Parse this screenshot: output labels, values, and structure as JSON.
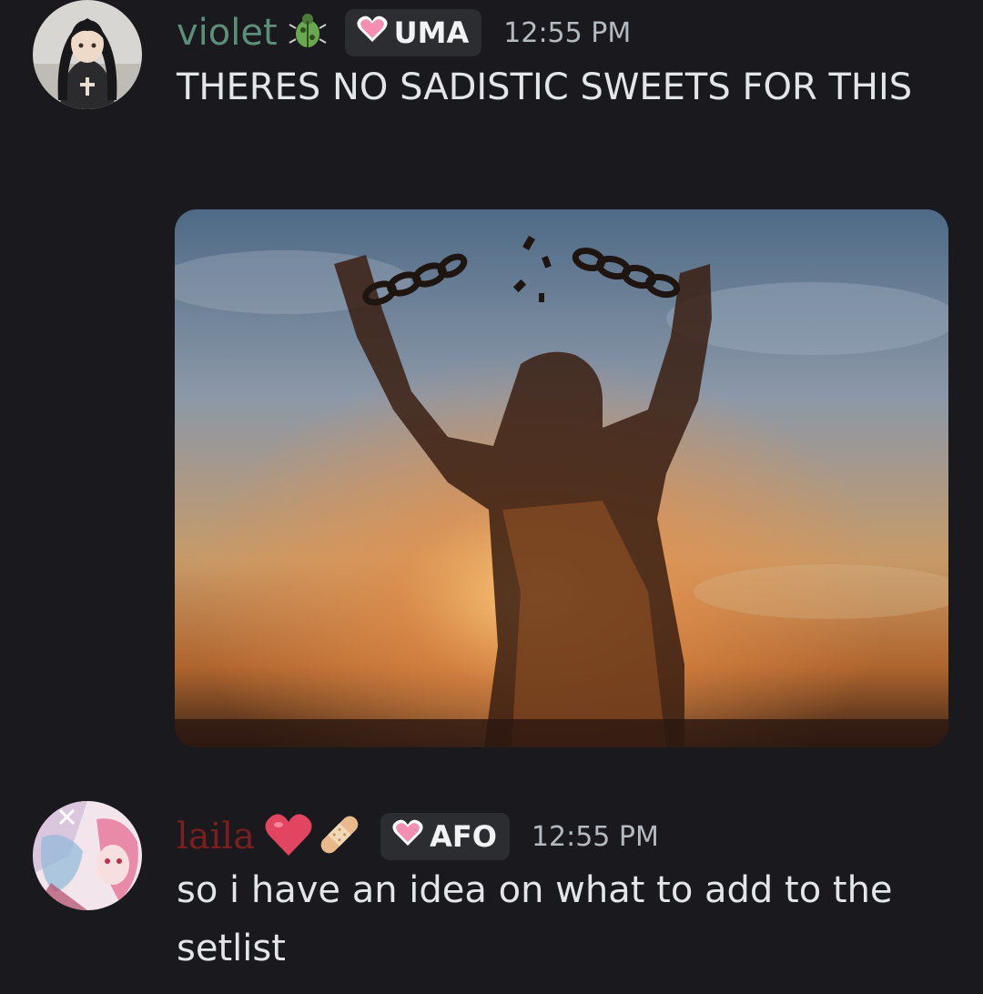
{
  "messages": [
    {
      "username": "violet",
      "username_color": "#5b8f79",
      "username_emoji": "beetle-icon",
      "tag": {
        "icon": "pink-heart-icon",
        "label": "UMA"
      },
      "timestamp": "12:55 PM",
      "text": "THERES NO SADISTIC SWEETS FOR THIS",
      "attachment": {
        "type": "image",
        "subject": "silhouette-breaking-chains-at-sunset"
      }
    },
    {
      "username": "laila",
      "username_color": "#7a1e1e",
      "username_emoji": [
        "red-heart-icon",
        "bandage-icon"
      ],
      "tag": {
        "icon": "pink-heart-icon",
        "label": "AFO"
      },
      "timestamp": "12:55 PM",
      "text": "so i have an idea on what to add to the setlist"
    }
  ],
  "colors": {
    "background": "#1a1a1e",
    "tag_background": "#2b2d31",
    "timestamp": "#b5bac1",
    "text": "#e3e5e8"
  }
}
